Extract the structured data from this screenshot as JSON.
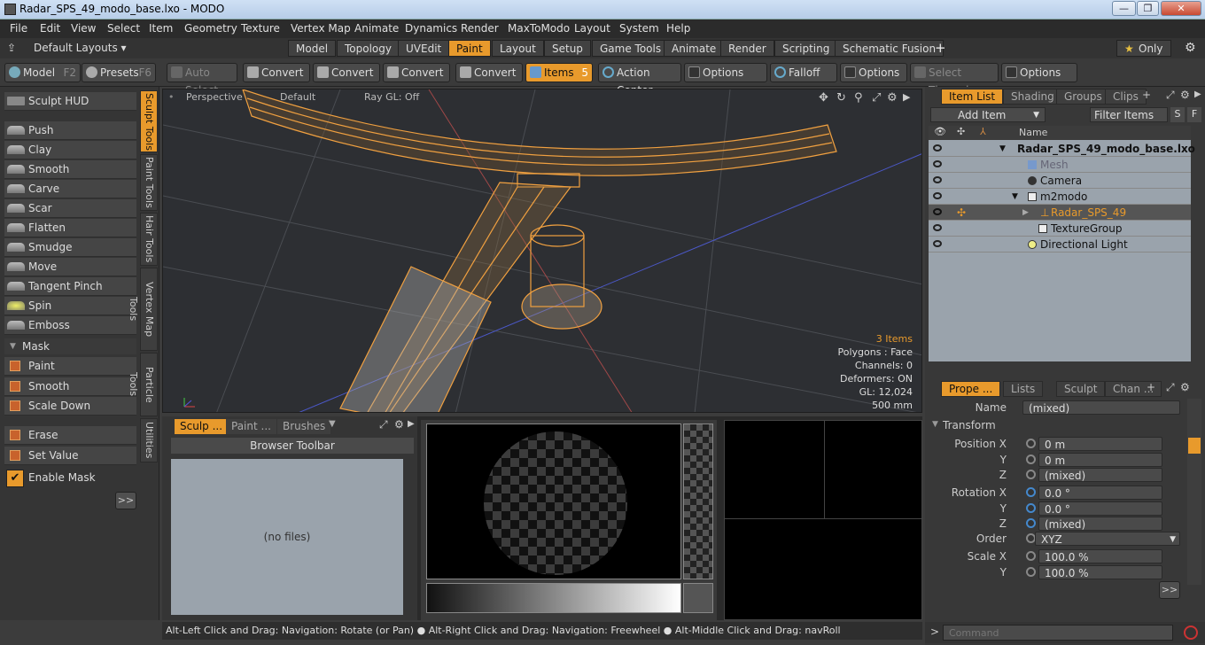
{
  "window": {
    "title": "Radar_SPS_49_modo_base.lxo - MODO",
    "minimize": "—",
    "maximize": "❐",
    "close": "✕"
  },
  "menu": [
    "File",
    "Edit",
    "View",
    "Select",
    "Item",
    "Geometry",
    "Texture",
    "Vertex Map",
    "Animate",
    "Dynamics",
    "Render",
    "MaxToModo",
    "Layout",
    "System",
    "Help"
  ],
  "layout_tabs": {
    "default_layouts": "Default Layouts ▾",
    "tabs": [
      "Model",
      "Topology",
      "UVEdit",
      "Paint",
      "Layout",
      "Setup",
      "Game Tools",
      "Animate",
      "Render",
      "Scripting",
      "Schematic Fusion"
    ],
    "active": "Paint",
    "add": "+",
    "only": "Only"
  },
  "toolbar": {
    "model": "Model",
    "model_key": "F2",
    "presets": "Presets",
    "presets_key": "F6",
    "auto_select": "Auto Select",
    "convert1": "Convert",
    "convert2": "Convert",
    "convert3": "Convert",
    "convert4": "Convert",
    "items": "Items",
    "items_count": "5",
    "action_center": "Action Center",
    "options1": "Options",
    "falloff": "Falloff",
    "options2": "Options",
    "select_through": "Select Through",
    "options3": "Options"
  },
  "sculpt": {
    "hud": "Sculpt HUD",
    "tools": [
      "Push",
      "Clay",
      "Smooth",
      "Carve",
      "Scar",
      "Flatten",
      "Smudge",
      "Move",
      "Tangent Pinch",
      "Spin",
      "Emboss"
    ],
    "mask_header": "Mask",
    "mask_tools": [
      "Paint",
      "Smooth",
      "Scale Down"
    ],
    "erase": "Erase",
    "set_value": "Set Value",
    "enable_mask": "Enable Mask",
    "more": ">>",
    "vtabs": [
      "Sculpt Tools",
      "Paint Tools",
      "Hair Tools",
      "Vertex Map Tools",
      "Particle Tools",
      "Utilities"
    ]
  },
  "viewport": {
    "view": "Perspective",
    "shading": "Default",
    "raygl": "Ray GL: Off",
    "stats": [
      "3 Items",
      "Polygons : Face",
      "Channels: 0",
      "Deformers: ON",
      "GL: 12,024",
      "500 mm"
    ]
  },
  "browser": {
    "tabs": [
      "Sculp ...",
      "Paint ...",
      "Brushes"
    ],
    "toolbar": "Browser Toolbar",
    "empty": "(no files)"
  },
  "status": "Alt-Left Click and Drag: Navigation: Rotate (or Pan) ● Alt-Right Click and Drag: Navigation: Freewheel ● Alt-Middle Click and Drag: navRoll",
  "items_panel": {
    "tabs": [
      "Item List",
      "Shading",
      "Groups",
      "Clips"
    ],
    "add_item": "Add Item",
    "filter": "Filter Items",
    "s": "S",
    "f": "F",
    "name_col": "Name",
    "rows": [
      "Radar_SPS_49_modo_base.lxo",
      "Mesh",
      "Camera",
      "m2modo",
      "Radar_SPS_49",
      "TextureGroup",
      "Directional Light"
    ]
  },
  "properties": {
    "tabs": [
      "Prope ...",
      "Lists",
      "Sculpt",
      "Chan ..."
    ],
    "name_label": "Name",
    "name_value": "(mixed)",
    "transform": "Transform",
    "pos_x_label": "Position X",
    "pos_x": "0 m",
    "pos_y_label": "Y",
    "pos_y": "0 m",
    "pos_z_label": "Z",
    "pos_z": "(mixed)",
    "rot_x_label": "Rotation X",
    "rot_x": "0.0 °",
    "rot_y_label": "Y",
    "rot_y": "0.0 °",
    "rot_z_label": "Z",
    "rot_z": "(mixed)",
    "order_label": "Order",
    "order": "XYZ",
    "scale_x_label": "Scale X",
    "scale_x": "100.0 %",
    "scale_y_label": "Y",
    "scale_y": "100.0 %",
    "more": ">>"
  },
  "command": {
    "prompt": ">",
    "placeholder": "Command"
  },
  "colors": {
    "accent": "#e89a2c",
    "wire": "#f0a040"
  }
}
